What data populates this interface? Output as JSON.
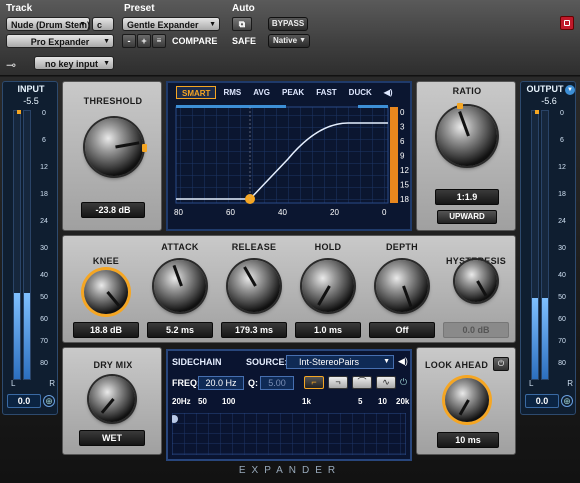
{
  "header": {
    "track_label": "Track",
    "preset_label": "Preset",
    "auto_label": "Auto",
    "track_name": "Nude (Drum Stem)",
    "track_channel": "c",
    "plugin_name": "Pro Expander",
    "preset_name": "Gentle Expander",
    "minus": "-",
    "plus": "+",
    "compare": "COMPARE",
    "safe": "SAFE",
    "bypass": "BYPASS",
    "format": "Native",
    "key_input": "no key input"
  },
  "input_meter": {
    "title": "INPUT",
    "value": "-5.5",
    "scale": [
      "0",
      "6",
      "12",
      "18",
      "24",
      "30",
      "40",
      "50",
      "60",
      "70",
      "80"
    ],
    "channels": [
      "L",
      "R"
    ],
    "level": 0.32,
    "gain": "0.0"
  },
  "output_meter": {
    "title": "OUTPUT",
    "value": "-5.6",
    "scale": [
      "0",
      "6",
      "12",
      "18",
      "24",
      "30",
      "40",
      "50",
      "60",
      "70",
      "80"
    ],
    "channels": [
      "L",
      "R"
    ],
    "level": 0.3,
    "gain": "0.0"
  },
  "threshold": {
    "label": "THRESHOLD",
    "value": "-23.8 dB"
  },
  "ratio": {
    "label": "RATIO",
    "value": "1:1.9",
    "mode": "UPWARD"
  },
  "graph": {
    "modes": [
      "SMART",
      "RMS",
      "AVG",
      "PEAK",
      "FAST",
      "DUCK"
    ],
    "x_ticks": [
      "80",
      "60",
      "40",
      "20",
      "0"
    ],
    "y_ticks": [
      "0",
      "3",
      "6",
      "9",
      "12",
      "15",
      "18"
    ]
  },
  "controls": [
    {
      "key": "knee",
      "label": "KNEE",
      "value": "18.8 dB"
    },
    {
      "key": "attack",
      "label": "ATTACK",
      "value": "5.2 ms"
    },
    {
      "key": "release",
      "label": "RELEASE",
      "value": "179.3 ms"
    },
    {
      "key": "hold",
      "label": "HOLD",
      "value": "1.0 ms"
    },
    {
      "key": "depth",
      "label": "DEPTH",
      "value": "Off"
    },
    {
      "key": "hysteresis",
      "label": "HYSTERESIS",
      "value": "0.0 dB"
    }
  ],
  "dry_mix": {
    "label": "DRY MIX",
    "value": "WET"
  },
  "sidechain": {
    "title": "SIDECHAIN",
    "source_label": "SOURCE:",
    "source_value": "Int-StereoPairs",
    "freq_label": "FREQ:",
    "freq_value": "20.0 Hz",
    "q_label": "Q:",
    "q_value": "5.00",
    "freq_ticks": [
      "20Hz",
      "50",
      "100",
      "1k",
      "5",
      "10",
      "20k"
    ]
  },
  "lookahead": {
    "label": "LOOK AHEAD",
    "value": "10 ms"
  },
  "footer": {
    "title": "EXPANDER"
  },
  "colors": {
    "accent": "#f5a623",
    "meter_blue": "#3d8fd6",
    "graph_line": "#e6f0ff"
  }
}
